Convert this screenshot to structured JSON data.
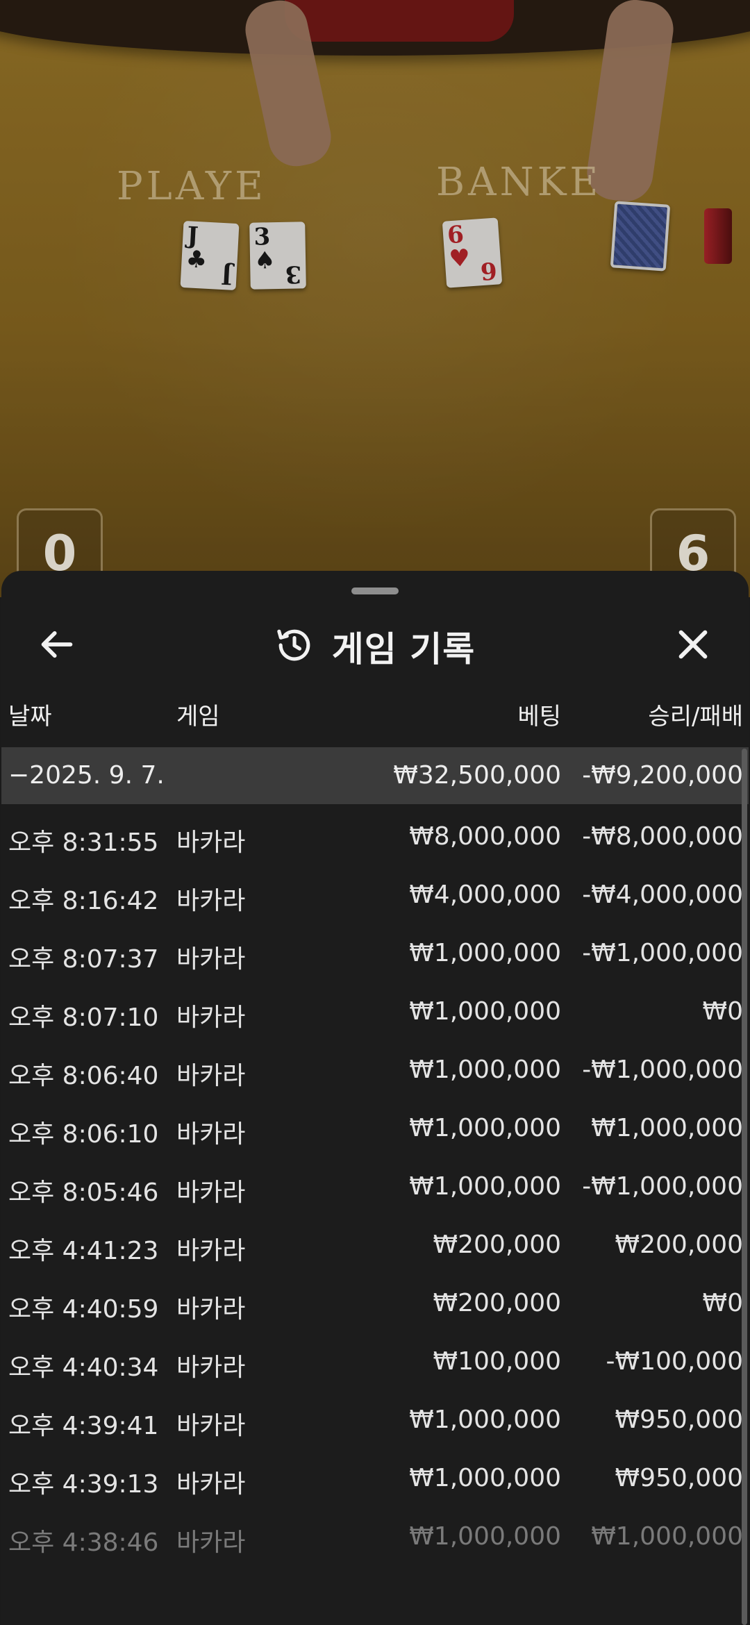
{
  "video": {
    "player_label": "PLAYE",
    "banker_label": "BANKE",
    "player_cards": [
      {
        "rank": "J",
        "suit": "♣",
        "color": "black"
      },
      {
        "rank": "3",
        "suit": "♠",
        "color": "black"
      }
    ],
    "banker_cards": [
      {
        "rank": "6",
        "suit": "♥",
        "color": "red"
      }
    ],
    "player_score": "0",
    "banker_score": "6"
  },
  "header": {
    "title": "게임 기록",
    "back_icon": "arrow-left-icon",
    "history_icon": "history-icon",
    "close_icon": "close-icon"
  },
  "columns": {
    "date": "날짜",
    "game": "게임",
    "bet": "베팅",
    "result": "승리/패배"
  },
  "day_summary": {
    "date": "−2025. 9. 7.",
    "bet": "₩32,500,000",
    "result": "-₩9,200,000"
  },
  "rows": [
    {
      "time": "오후 8:31:55",
      "game": "바카라",
      "bet": "₩8,000,000",
      "result": "-₩8,000,000"
    },
    {
      "time": "오후 8:16:42",
      "game": "바카라",
      "bet": "₩4,000,000",
      "result": "-₩4,000,000"
    },
    {
      "time": "오후 8:07:37",
      "game": "바카라",
      "bet": "₩1,000,000",
      "result": "-₩1,000,000"
    },
    {
      "time": "오후 8:07:10",
      "game": "바카라",
      "bet": "₩1,000,000",
      "result": "₩0"
    },
    {
      "time": "오후 8:06:40",
      "game": "바카라",
      "bet": "₩1,000,000",
      "result": "-₩1,000,000"
    },
    {
      "time": "오후 8:06:10",
      "game": "바카라",
      "bet": "₩1,000,000",
      "result": "₩1,000,000"
    },
    {
      "time": "오후 8:05:46",
      "game": "바카라",
      "bet": "₩1,000,000",
      "result": "-₩1,000,000"
    },
    {
      "time": "오후 4:41:23",
      "game": "바카라",
      "bet": "₩200,000",
      "result": "₩200,000"
    },
    {
      "time": "오후 4:40:59",
      "game": "바카라",
      "bet": "₩200,000",
      "result": "₩0"
    },
    {
      "time": "오후 4:40:34",
      "game": "바카라",
      "bet": "₩100,000",
      "result": "-₩100,000"
    },
    {
      "time": "오후 4:39:41",
      "game": "바카라",
      "bet": "₩1,000,000",
      "result": "₩950,000"
    },
    {
      "time": "오후 4:39:13",
      "game": "바카라",
      "bet": "₩1,000,000",
      "result": "₩950,000"
    },
    {
      "time": "오후 4:38:46",
      "game": "바카라",
      "bet": "₩1,000,000",
      "result": "₩1,000,000"
    }
  ]
}
